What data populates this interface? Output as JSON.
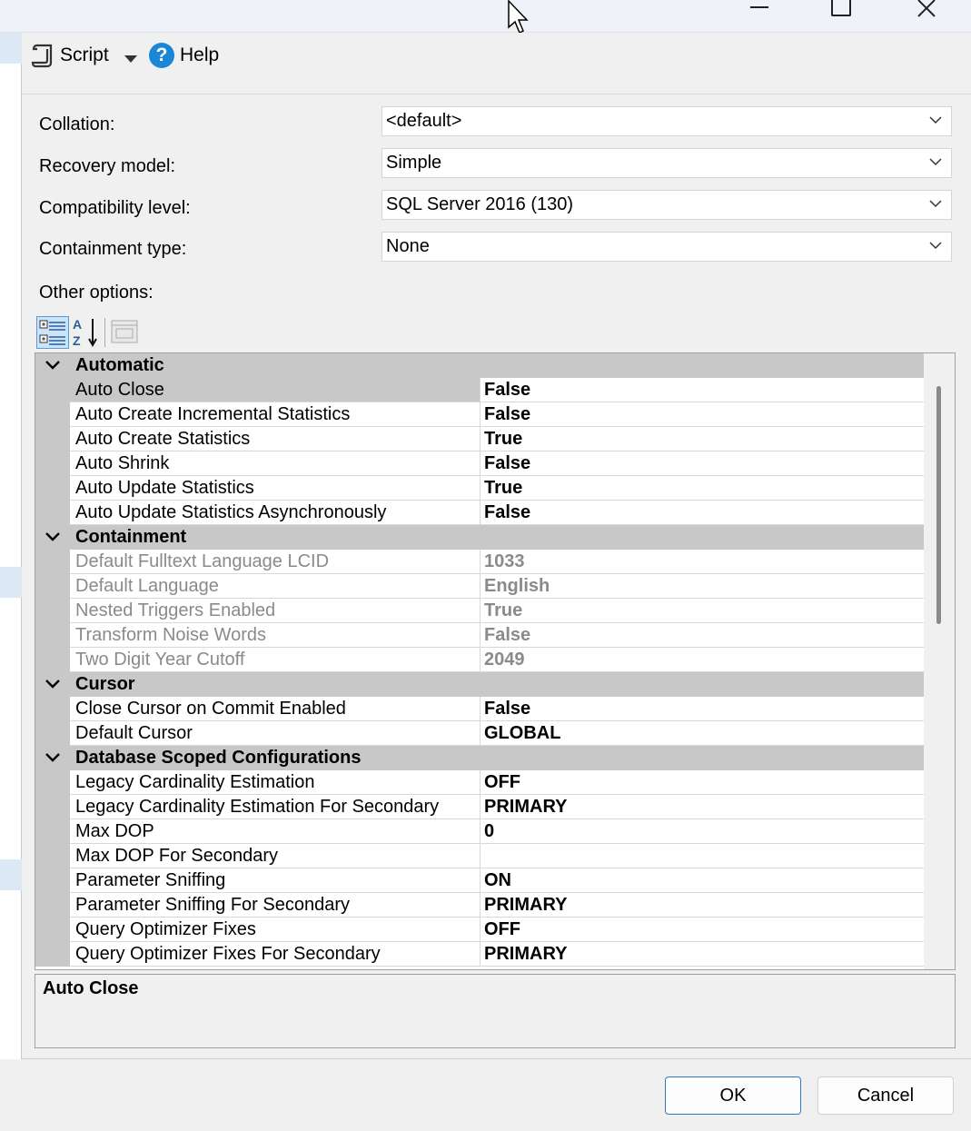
{
  "toolbar": {
    "script_label": "Script",
    "help_label": "Help"
  },
  "form": {
    "collation": {
      "label": "Collation:",
      "value": "<default>"
    },
    "recovery_model": {
      "label": "Recovery model:",
      "value": "Simple"
    },
    "compatibility_level": {
      "label": "Compatibility level:",
      "value": "SQL Server 2016 (130)"
    },
    "containment_type": {
      "label": "Containment type:",
      "value": "None"
    },
    "other_options_label": "Other options:"
  },
  "grid": {
    "categories": [
      {
        "name": "Automatic",
        "rows": [
          {
            "name": "Auto Close",
            "value": "False"
          },
          {
            "name": "Auto Create Incremental Statistics",
            "value": "False"
          },
          {
            "name": "Auto Create Statistics",
            "value": "True"
          },
          {
            "name": "Auto Shrink",
            "value": "False"
          },
          {
            "name": "Auto Update Statistics",
            "value": "True"
          },
          {
            "name": "Auto Update Statistics Asynchronously",
            "value": "False"
          }
        ]
      },
      {
        "name": "Containment",
        "rows": [
          {
            "name": "Default Fulltext Language LCID",
            "value": "1033"
          },
          {
            "name": "Default Language",
            "value": "English"
          },
          {
            "name": "Nested Triggers Enabled",
            "value": "True"
          },
          {
            "name": "Transform Noise Words",
            "value": "False"
          },
          {
            "name": "Two Digit Year Cutoff",
            "value": "2049"
          }
        ]
      },
      {
        "name": "Cursor",
        "rows": [
          {
            "name": "Close Cursor on Commit Enabled",
            "value": "False"
          },
          {
            "name": "Default Cursor",
            "value": "GLOBAL"
          }
        ]
      },
      {
        "name": "Database Scoped Configurations",
        "rows": [
          {
            "name": "Legacy Cardinality Estimation",
            "value": "OFF"
          },
          {
            "name": "Legacy Cardinality Estimation For Secondary",
            "value": "PRIMARY"
          },
          {
            "name": "Max DOP",
            "value": "0"
          },
          {
            "name": "Max DOP For Secondary",
            "value": ""
          },
          {
            "name": "Parameter Sniffing",
            "value": "ON"
          },
          {
            "name": "Parameter Sniffing For Secondary",
            "value": "PRIMARY"
          },
          {
            "name": "Query Optimizer Fixes",
            "value": "OFF"
          },
          {
            "name": "Query Optimizer Fixes For Secondary",
            "value": "PRIMARY"
          }
        ]
      }
    ]
  },
  "description": {
    "title": "Auto Close"
  },
  "buttons": {
    "ok": "OK",
    "cancel": "Cancel"
  }
}
